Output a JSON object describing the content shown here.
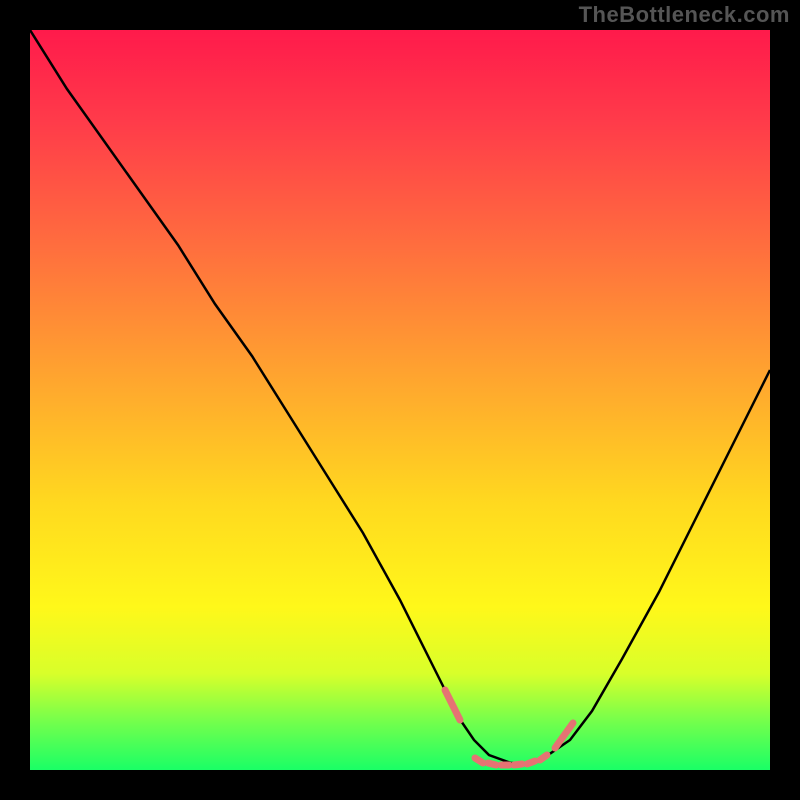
{
  "watermark": "TheBottleneck.com",
  "colors": {
    "background": "#000000",
    "gradient_top": "#ff1a4b",
    "gradient_mid": "#ffd91f",
    "gradient_bottom": "#1aff66",
    "curve": "#000000",
    "markers": "#e57373"
  },
  "chart_data": {
    "type": "line",
    "title": "",
    "xlabel": "",
    "ylabel": "",
    "xlim": [
      0,
      100
    ],
    "ylim": [
      0,
      100
    ],
    "grid": false,
    "legend": false,
    "series": [
      {
        "name": "bottleneck-curve",
        "x": [
          0,
          5,
          10,
          15,
          20,
          25,
          30,
          35,
          40,
          45,
          50,
          55,
          58,
          60,
          62,
          65,
          68,
          70,
          73,
          76,
          80,
          85,
          90,
          95,
          100
        ],
        "y": [
          100,
          92,
          85,
          78,
          71,
          63,
          56,
          48,
          40,
          32,
          23,
          13,
          7,
          4,
          2,
          1,
          1,
          2,
          4,
          8,
          15,
          24,
          34,
          44,
          54
        ]
      }
    ],
    "annotations": [
      {
        "kind": "marker-segment",
        "x_range": [
          56,
          58
        ],
        "note": "left pink marker"
      },
      {
        "kind": "marker-cluster",
        "x_range": [
          60,
          69
        ],
        "note": "bottom pink marker cluster"
      },
      {
        "kind": "marker-segment",
        "x_range": [
          70,
          73
        ],
        "note": "right pink marker"
      }
    ]
  }
}
